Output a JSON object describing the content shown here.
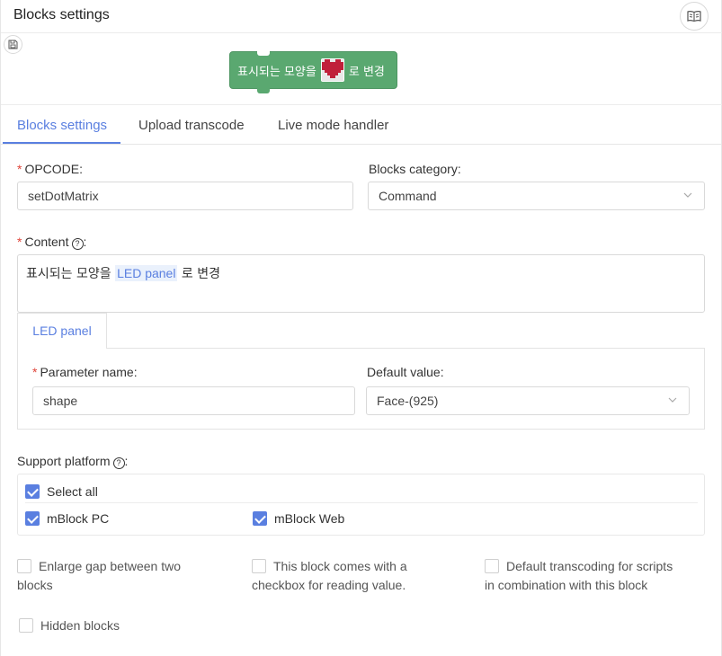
{
  "header": {
    "title": "Blocks settings"
  },
  "icons": {
    "help": "book-icon",
    "save": "save-icon"
  },
  "preview": {
    "block_text_before": "표시되는 모양을",
    "block_text_after": "로 변경",
    "block_color": "#5aa870",
    "heart_color": "#c0203a"
  },
  "tabs": [
    {
      "label": "Blocks settings",
      "active": true
    },
    {
      "label": "Upload transcode",
      "active": false
    },
    {
      "label": "Live mode handler",
      "active": false
    }
  ],
  "form": {
    "opcode": {
      "label": "OPCODE:",
      "value": "setDotMatrix"
    },
    "category": {
      "label": "Blocks category:",
      "value": "Command"
    },
    "content": {
      "label": "Content",
      "label_suffix": ":",
      "text_before": "표시되는 모양을",
      "param_tag": "LED panel",
      "text_after": "로 변경"
    },
    "param_tab": {
      "label": "LED panel"
    },
    "param_name": {
      "label": "Parameter name:",
      "value": "shape"
    },
    "default_value": {
      "label": "Default value:",
      "value": "Face-(925)"
    },
    "support_platform": {
      "label": "Support platform",
      "label_suffix": ":",
      "select_all": {
        "label": "Select all",
        "checked": true
      },
      "platforms": [
        {
          "label": "mBlock PC",
          "checked": true
        },
        {
          "label": "mBlock Web",
          "checked": true
        }
      ]
    },
    "options": [
      {
        "label_line1": "Enlarge gap between two",
        "label_line2": "blocks",
        "checked": false
      },
      {
        "label_line1": "This block comes with a",
        "label_line2": "checkbox for reading value.",
        "checked": false
      },
      {
        "label_line1": "Default transcoding for scripts",
        "label_line2": "in combination with this block",
        "checked": false
      },
      {
        "label_line1": "Hidden blocks",
        "label_line2": "",
        "checked": false
      }
    ]
  },
  "accent_color": "#5a7fe0",
  "required_color": "#e0443a"
}
